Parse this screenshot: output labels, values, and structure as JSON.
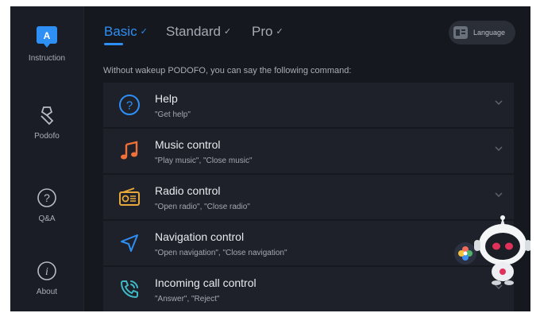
{
  "sidebar": {
    "items": [
      {
        "label": "Instruction",
        "icon": "instruction-icon",
        "glyph": "A",
        "active": true
      },
      {
        "label": "Podofo",
        "icon": "podofo-icon"
      },
      {
        "label": "Q&A",
        "icon": "question-icon",
        "glyph": "?"
      },
      {
        "label": "About",
        "icon": "info-icon",
        "glyph": "i"
      }
    ]
  },
  "tabs": [
    {
      "label": "Basic",
      "check": "✓",
      "active": true
    },
    {
      "label": "Standard",
      "check": "✓",
      "active": false
    },
    {
      "label": "Pro",
      "check": "✓",
      "active": false
    }
  ],
  "language": {
    "label": "Language",
    "icon": "language-icon"
  },
  "intro": "Without wakeup PODOFO, you can say the following command:",
  "commands": [
    {
      "title": "Help",
      "subtitle": "\"Get help\"",
      "icon": "help-icon",
      "glyph": "?"
    },
    {
      "title": "Music control",
      "subtitle": "\"Play music\", \"Close music\"",
      "icon": "music-note-icon"
    },
    {
      "title": "Radio control",
      "subtitle": "\"Open radio\", \"Close radio\"",
      "icon": "radio-icon"
    },
    {
      "title": "Navigation control",
      "subtitle": "\"Open navigation\", \"Close navigation\"",
      "icon": "navigation-arrow-icon"
    },
    {
      "title": "Incoming call control",
      "subtitle": "\"Answer\", \"Reject\"",
      "icon": "phone-call-icon"
    }
  ],
  "colors": {
    "background": "#15181f",
    "sidebar": "#1a1d25",
    "row": "#1e2129",
    "accent": "#2e8ff5",
    "music": "#f0703a",
    "radio": "#e9a93a",
    "text": "#e8eaee",
    "muted": "#a3a8b1"
  }
}
